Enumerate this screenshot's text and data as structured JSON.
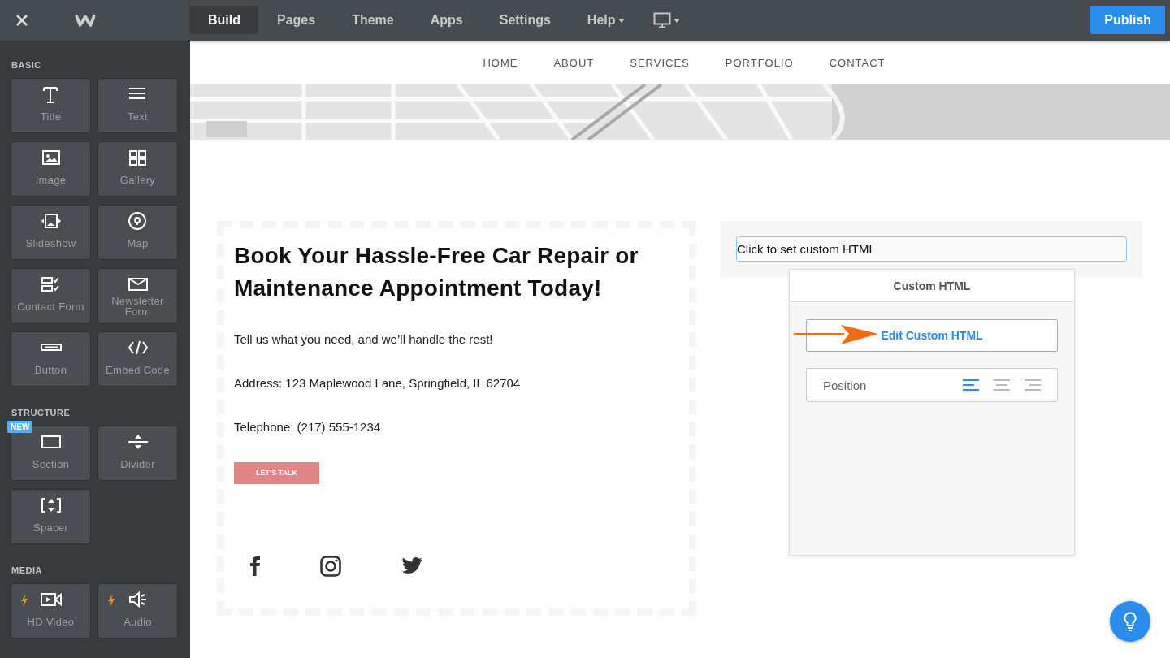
{
  "topbar": {
    "tabs": [
      {
        "label": "Build",
        "selected": true,
        "dropdown": false
      },
      {
        "label": "Pages",
        "selected": false,
        "dropdown": false
      },
      {
        "label": "Theme",
        "selected": false,
        "dropdown": false
      },
      {
        "label": "Apps",
        "selected": false,
        "dropdown": false
      },
      {
        "label": "Settings",
        "selected": false,
        "dropdown": false
      },
      {
        "label": "Help",
        "selected": false,
        "dropdown": true
      }
    ],
    "publish": "Publish"
  },
  "sidebar": {
    "sections": [
      {
        "title": "BASIC",
        "items": [
          {
            "label": "Title",
            "premium": false
          },
          {
            "label": "Text",
            "premium": false
          },
          {
            "label": "Image",
            "premium": false
          },
          {
            "label": "Gallery",
            "premium": false
          },
          {
            "label": "Slideshow",
            "premium": false
          },
          {
            "label": "Map",
            "premium": false
          },
          {
            "label": "Contact Form",
            "premium": false
          },
          {
            "label": "Newsletter Form",
            "premium": false
          },
          {
            "label": "Button",
            "premium": false
          },
          {
            "label": "Embed Code",
            "premium": false
          }
        ]
      },
      {
        "title": "STRUCTURE",
        "items": [
          {
            "label": "Section",
            "premium": false,
            "badge": "NEW"
          },
          {
            "label": "Divider",
            "premium": false
          },
          {
            "label": "Spacer",
            "premium": false
          }
        ]
      },
      {
        "title": "MEDIA",
        "items": [
          {
            "label": "HD Video",
            "premium": true
          },
          {
            "label": "Audio",
            "premium": true
          }
        ]
      }
    ]
  },
  "site": {
    "nav": [
      "HOME",
      "ABOUT",
      "SERVICES",
      "PORTFOLIO",
      "CONTACT"
    ],
    "header_image": {
      "kind": "picture"
    },
    "heading": "Book Your Hassle-Free Car Repair or Maintenance Appointment Today!",
    "paragraphs": [
      "Tell us what you need, and we’ll handle the rest!",
      "Address: 123 Maplewood Lane, Springfield, IL 62704",
      "Telephone: (217) 555-1234"
    ],
    "cta": "LET'S TALK",
    "custom_html": {
      "placeholder": "Click to set custom HTML"
    }
  },
  "popover": {
    "title": "Custom HTML",
    "edit_button": "Edit Custom HTML",
    "position_label": "Position",
    "alignments": [
      {
        "kind": "left",
        "selected": true
      },
      {
        "kind": "center",
        "selected": false
      },
      {
        "kind": "right",
        "selected": false
      }
    ]
  }
}
